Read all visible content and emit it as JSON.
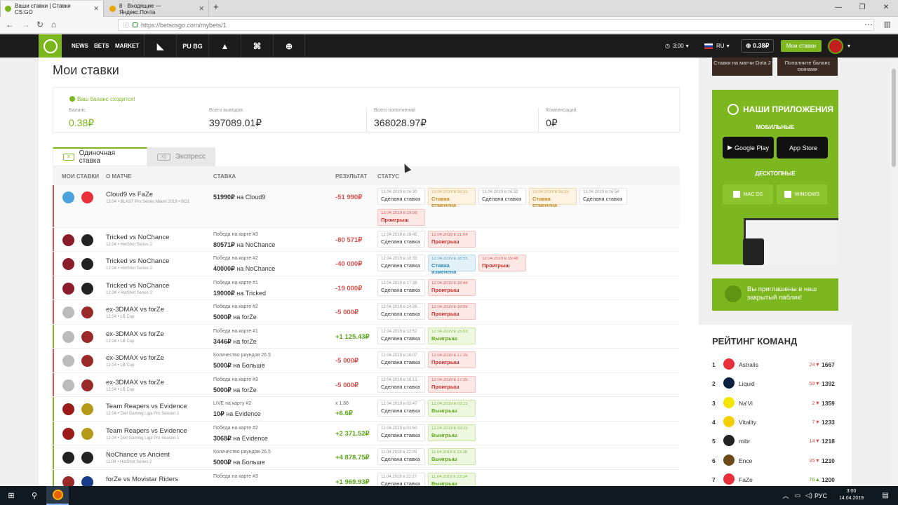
{
  "browser": {
    "tabs": [
      {
        "title": "Ваши ставки | Ставки CS:GO",
        "active": true,
        "favicon_color": "#7db71f"
      },
      {
        "title": "8 · Входящие — Яндекс.Почта",
        "active": false,
        "favicon_color": "#e8a400"
      }
    ],
    "url": "https://betscsgo.com/mybets/1"
  },
  "site_header": {
    "nav": [
      "NEWS",
      "BETS",
      "MARKET"
    ],
    "game_icons": [
      "dota2-icon",
      "pubg-icon",
      "artifact-icon",
      "gamepad-icon",
      "overwatch-icon"
    ],
    "pubg_text": "PU BG",
    "time": "3:00",
    "lang": "RU",
    "balance": "0.38₽",
    "mybets_btn": "Мои ставки"
  },
  "page": {
    "title": "Мои ставки",
    "balance_ok": "Ваш баланс сходится!",
    "stats": [
      {
        "label": "Баланс",
        "value": "0.38₽",
        "green": true
      },
      {
        "label": "Всего выводов",
        "value": "397089.01₽"
      },
      {
        "label": "Всего пополнений",
        "value": "368028.97₽"
      },
      {
        "label": "Компенсаций",
        "value": "0₽"
      }
    ],
    "tabs": {
      "single": "Одиночная ставка",
      "express": "Экспресс",
      "single_icon": "x",
      "express_icon": "x||"
    },
    "headers": {
      "mybets": "МОИ СТАВКИ",
      "match": "О МАТЧЕ",
      "bet": "СТАВКА",
      "result": "РЕЗУЛЬТАТ",
      "status": "СТАТУС"
    },
    "rows": [
      {
        "match": "Cloud9 vs FaZe",
        "tour": "13.04 • BLAST Pro Series Miami 2019 • BO1",
        "bet_label": "",
        "amount": "51990₽",
        "on": "на",
        "pick": "Cloud9",
        "result": "-51 990₽",
        "neg": true,
        "statuses": [
          {
            "d": "13.04.2019 в 16:30",
            "s": "Сделана ставка",
            "k": "done"
          },
          {
            "d": "13.04.2019 в 16:31",
            "s": "Ставка отменена",
            "k": "cancel"
          },
          {
            "d": "13.04.2019 в 16:32",
            "s": "Сделана ставка",
            "k": "done"
          },
          {
            "d": "13.04.2019 в 16:33",
            "s": "Ставка отменена",
            "k": "cancel"
          },
          {
            "d": "13.04.2019 в 16:54",
            "s": "Сделана ставка",
            "k": "done"
          },
          {
            "d": "13.04.2019 в 19:58",
            "s": "Проигрыш",
            "k": "lose"
          }
        ]
      },
      {
        "match": "Tricked vs NoChance",
        "tour": "12.04 • HotShot Series 2",
        "bet_label": "Победа на карте #3",
        "amount": "80571₽",
        "on": "на",
        "pick": "NoChance",
        "result": "-80 571₽",
        "neg": true,
        "statuses": [
          {
            "d": "12.04.2019 в 19:45",
            "s": "Сделана ставка",
            "k": "done"
          },
          {
            "d": "12.04.2019 в 21:04",
            "s": "Проигрыш",
            "k": "lose"
          }
        ]
      },
      {
        "match": "Tricked vs NoChance",
        "tour": "12.04 • HotShot Series 2",
        "bet_label": "Победа на карте #2",
        "amount": "40000₽",
        "on": "на",
        "pick": "NoChance",
        "result": "-40 000₽",
        "neg": true,
        "statuses": [
          {
            "d": "12.04.2019 в 18:33",
            "s": "Сделана ставка",
            "k": "done"
          },
          {
            "d": "12.04.2019 в 18:55",
            "s": "Ставка изменена",
            "k": "change"
          },
          {
            "d": "12.04.2019 в 19:48",
            "s": "Проигрыш",
            "k": "lose"
          }
        ]
      },
      {
        "match": "Tricked vs NoChance",
        "tour": "12.04 • HotShot Series 2",
        "bet_label": "Победа на карте #1",
        "amount": "19000₽",
        "on": "на",
        "pick": "Tricked",
        "result": "-19 000₽",
        "neg": true,
        "statuses": [
          {
            "d": "12.04.2019 в 17:38",
            "s": "Сделана ставка",
            "k": "done"
          },
          {
            "d": "12.04.2019 в 18:46",
            "s": "Проигрыш",
            "k": "lose"
          }
        ]
      },
      {
        "match": "ex-3DMAX vs forZe",
        "tour": "12.04 • LB Cup",
        "bet_label": "Победа на карте #2",
        "amount": "5000₽",
        "on": "на",
        "pick": "forZe",
        "result": "-5 000₽",
        "neg": true,
        "statuses": [
          {
            "d": "12.04.2019 в 14:58",
            "s": "Сделана ставка",
            "k": "done"
          },
          {
            "d": "12.04.2019 в 16:09",
            "s": "Проигрыш",
            "k": "lose"
          }
        ]
      },
      {
        "match": "ex-3DMAX vs forZe",
        "tour": "12.04 • LB Cup",
        "bet_label": "Победа на карте #1",
        "amount": "3446₽",
        "on": "на",
        "pick": "forZe",
        "result": "+1 125.43₽",
        "neg": false,
        "statuses": [
          {
            "d": "12.04.2019 в 13:52",
            "s": "Сделана ставка",
            "k": "done"
          },
          {
            "d": "12.04.2019 в 15:03",
            "s": "Выигрыш",
            "k": "win"
          }
        ]
      },
      {
        "match": "ex-3DMAX vs forZe",
        "tour": "12.04 • LB Cup",
        "bet_label": "Количество раундов 26.5",
        "amount": "5000₽",
        "on": "на",
        "pick": "Больше",
        "result": "-5 000₽",
        "neg": true,
        "statuses": [
          {
            "d": "12.04.2019 в 16:07",
            "s": "Сделана ставка",
            "k": "done"
          },
          {
            "d": "12.04.2019 в 17:35",
            "s": "Проигрыш",
            "k": "lose"
          }
        ]
      },
      {
        "match": "ex-3DMAX vs forZe",
        "tour": "12.04 • LB Cup",
        "bet_label": "Победа на карте #3",
        "amount": "5000₽",
        "on": "на",
        "pick": "forZe",
        "result": "-5 000₽",
        "neg": true,
        "statuses": [
          {
            "d": "12.04.2019 в 16:13",
            "s": "Сделана ставка",
            "k": "done"
          },
          {
            "d": "12.04.2019 в 17:35",
            "s": "Проигрыш",
            "k": "lose"
          }
        ]
      },
      {
        "match": "Team Reapers vs Evidence",
        "tour": "12.04 • Dell Gaming Liga Pro Season 1",
        "bet_label": "LIVE на карту #2",
        "amount": "10₽",
        "on": "на",
        "pick": "Evidence",
        "result": "+6.6₽",
        "result_top": "x 1.66",
        "neg": false,
        "statuses": [
          {
            "d": "12.04.2019 в 02:47",
            "s": "Сделана ставка",
            "k": "done"
          },
          {
            "d": "12.04.2019 в 03:15",
            "s": "Выигрыш",
            "k": "win"
          }
        ]
      },
      {
        "match": "Team Reapers vs Evidence",
        "tour": "12.04 • Dell Gaming Liga Pro Season 1",
        "bet_label": "Победа на карте #2",
        "amount": "3068₽",
        "on": "на",
        "pick": "Evidence",
        "result": "+2 371.52₽",
        "neg": false,
        "statuses": [
          {
            "d": "12.04.2019 в 01:50",
            "s": "Сделана ставка",
            "k": "done"
          },
          {
            "d": "12.04.2019 в 03:15",
            "s": "Выигрыш",
            "k": "win"
          }
        ]
      },
      {
        "match": "NoChance vs Ancient",
        "tour": "11.04 • HotShot Series 2",
        "bet_label": "Количество раундов 26.5",
        "amount": "5000₽",
        "on": "на",
        "pick": "Больше",
        "result": "+4 878.75₽",
        "neg": false,
        "statuses": [
          {
            "d": "11.04.2019 в 22:09",
            "s": "Сделана ставка",
            "k": "done"
          },
          {
            "d": "11.04.2019 в 23:16",
            "s": "Выигрыш",
            "k": "win"
          }
        ]
      },
      {
        "match": "forZe vs Movistar Riders",
        "tour": "",
        "bet_label": "Победа на карте #3",
        "amount": "",
        "on": "",
        "pick": "",
        "result": "+1 969.93₽",
        "neg": false,
        "statuses": [
          {
            "d": "11.04.2019 в 22:27",
            "s": "Сделана ставка",
            "k": "done"
          },
          {
            "d": "11.04.2019 в 23:24",
            "s": "Выигрыш",
            "k": "win"
          }
        ]
      }
    ]
  },
  "sidebar": {
    "promos": [
      "Ставки на матчи Dota 2",
      "Пополните баланс скинами"
    ],
    "apps_title": "НАШИ ПРИЛОЖЕНИЯ",
    "mobile": "МОБИЛЬНЫЕ",
    "google_play": "Google Play",
    "app_store": "App Store",
    "desktop": "ДЕСКТОПНЫЕ",
    "mac": "MAC OS",
    "windows": "WINDOWS",
    "invite": "Вы приглашены в наш закрытый паблик!",
    "rating_title": "РЕЙТИНГ КОМАНД",
    "rating": [
      {
        "n": "1",
        "name": "Astralis",
        "change": "24",
        "pts": "1667",
        "color": "#e8303a"
      },
      {
        "n": "2",
        "name": "Liquid",
        "change": "59",
        "pts": "1392",
        "color": "#0a2240"
      },
      {
        "n": "3",
        "name": "Na'Vi",
        "change": "2",
        "pts": "1359",
        "color": "#f5e400"
      },
      {
        "n": "4",
        "name": "Vitality",
        "change": "7",
        "pts": "1233",
        "color": "#f5d000"
      },
      {
        "n": "5",
        "name": "mibr",
        "change": "14",
        "pts": "1218",
        "color": "#222222"
      },
      {
        "n": "6",
        "name": "Ence",
        "change": "35",
        "pts": "1210",
        "color": "#6a4a1a"
      },
      {
        "n": "7",
        "name": "FaZe",
        "change": "76",
        "pts": "1200",
        "color": "#e8303a"
      }
    ]
  },
  "taskbar": {
    "time": "3:00",
    "date": "14.04.2019",
    "lang": "РУС"
  }
}
